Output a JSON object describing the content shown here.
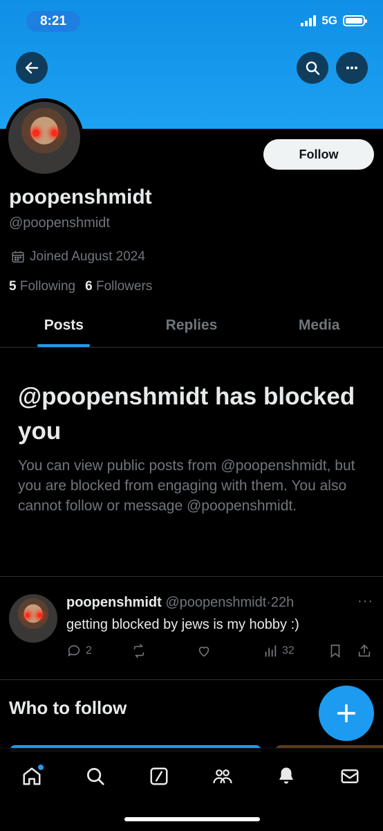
{
  "status_bar": {
    "time": "8:21",
    "network": "5G"
  },
  "icons": {
    "back": "arrow-left-icon",
    "search": "search-icon",
    "more": "more-icon",
    "calendar": "calendar-icon",
    "reply": "comment-icon",
    "retweet": "retweet-icon",
    "like": "heart-icon",
    "views": "bar-chart-icon",
    "bookmark": "bookmark-icon",
    "share": "share-icon",
    "compose": "plus-icon"
  },
  "colors": {
    "accent": "#1d9bf0",
    "banner": "#1da1f2",
    "muted": "#71767b",
    "text": "#e7e9ea"
  },
  "profile": {
    "follow_label": "Follow",
    "display_name": "poopenshmidt",
    "handle": "@poopenshmidt",
    "joined": "Joined August 2024",
    "following_count": "5",
    "following_label": "Following",
    "followers_count": "6",
    "followers_label": "Followers"
  },
  "tabs": [
    {
      "label": "Posts",
      "active": true
    },
    {
      "label": "Replies",
      "active": false
    },
    {
      "label": "Media",
      "active": false
    }
  ],
  "blocked_notice": {
    "title": "@poopenshmidt has blocked you",
    "body": "You can view public posts from @poopenshmidt, but you are blocked from engaging with them. You also cannot follow or message @poopenshmidt."
  },
  "post": {
    "name": "poopenshmidt",
    "handle_time": "@poopenshmidt·22h",
    "more": "···",
    "text": "getting blocked by jews is my hobby :)",
    "replies": "2",
    "views": "32"
  },
  "who_to_follow": {
    "title": "Who to follow"
  },
  "bottom_nav": [
    {
      "name": "home",
      "icon": "home-icon",
      "has_badge": true
    },
    {
      "name": "search",
      "icon": "search-icon"
    },
    {
      "name": "grok",
      "icon": "grok-icon"
    },
    {
      "name": "communities",
      "icon": "people-icon"
    },
    {
      "name": "notifications",
      "icon": "bell-icon"
    },
    {
      "name": "messages",
      "icon": "mail-icon"
    }
  ]
}
